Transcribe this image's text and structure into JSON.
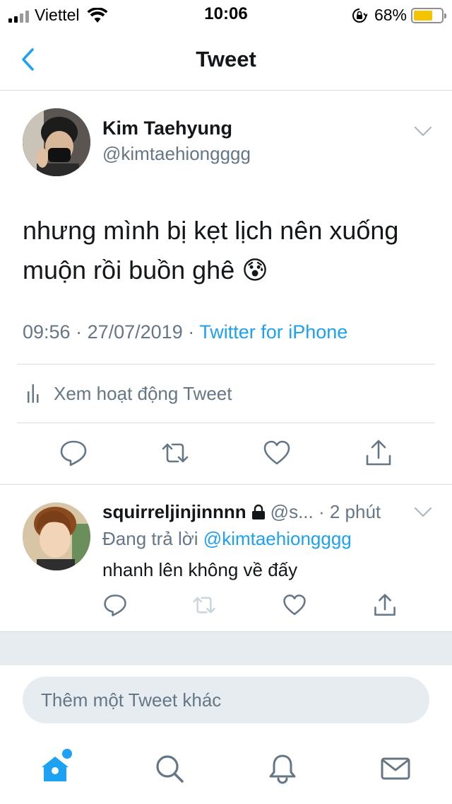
{
  "status_bar": {
    "carrier": "Viettel",
    "time": "10:06",
    "battery_percent": "68%",
    "battery_level": 0.68,
    "battery_color": "#f5c400"
  },
  "nav": {
    "back_icon": "chevron-left-icon",
    "title": "Tweet"
  },
  "tweet": {
    "author_name": "Kim Taehyung",
    "author_handle": "@kimtaehiongggg",
    "text_line1": "nhưng mình bị kẹt lịch nên xuống",
    "text_line2": "muộn rồi buồn ghê 😰",
    "time": "09:56",
    "separator": " · ",
    "date": "27/07/2019",
    "source": "Twitter for iPhone",
    "activity_label": "Xem hoạt động Tweet",
    "actions": [
      "reply-icon",
      "retweet-icon",
      "like-icon",
      "share-icon"
    ]
  },
  "reply": {
    "author_name": "squirreljinjinnnn",
    "author_handle": "@s...",
    "time": "· 2 phút",
    "replying_prefix": "Đang trả lời",
    "replying_to": "@kimtaehiongggg",
    "text": "nhanh lên không về đấy",
    "actions": [
      "reply-icon",
      "retweet-icon",
      "like-icon",
      "share-icon"
    ]
  },
  "compose": {
    "placeholder": "Thêm một Tweet khác"
  },
  "tabbar": {
    "tabs": [
      "home-icon",
      "search-icon",
      "notifications-icon",
      "messages-icon"
    ]
  },
  "colors": {
    "accent": "#1da1f2",
    "secondary_text": "#657786",
    "primary_text": "#14171a",
    "divider": "#d8dde1",
    "separator_background": "#e6ecf0"
  }
}
